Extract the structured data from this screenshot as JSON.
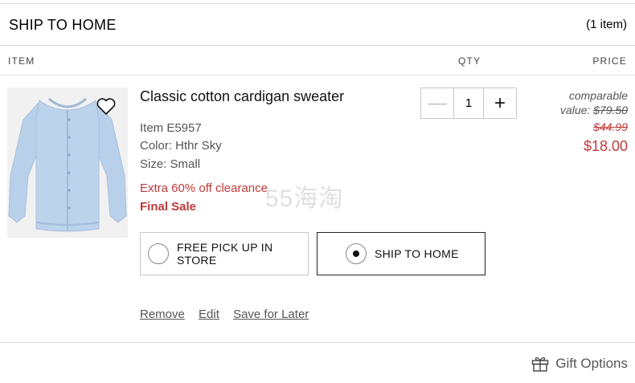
{
  "section": {
    "title": "SHIP TO HOME",
    "item_count": "(1 item)"
  },
  "columns": {
    "item": "ITEM",
    "qty": "QTY",
    "price": "PRICE"
  },
  "product": {
    "name": "Classic cotton cardigan sweater",
    "item_number": "Item E5957",
    "color": "Color: Hthr Sky",
    "size": "Size: Small",
    "promo": "Extra 60% off clearance",
    "final_sale": "Final Sale",
    "image_icon": "cardigan-sweater-image",
    "sweater_color": "#bcd3ec",
    "wishlist_icon": "heart-icon"
  },
  "quantity": {
    "value": "1",
    "minus_icon": "minus-icon",
    "plus_icon": "plus-icon"
  },
  "price": {
    "comparable_label": "comparable",
    "comparable_value_label": "value:",
    "comparable_value": "$79.50",
    "original": "$44.99",
    "sale": "$18.00",
    "sale_color": "#c0393a"
  },
  "shipping_options": {
    "pickup_label": "FREE PICK UP IN STORE",
    "home_label": "SHIP TO HOME",
    "selected": "home"
  },
  "actions": {
    "remove": "Remove",
    "edit": "Edit",
    "save_for_later": "Save for Later"
  },
  "gift": {
    "label": "Gift Options",
    "icon": "gift-icon"
  },
  "watermark": "55海淘"
}
